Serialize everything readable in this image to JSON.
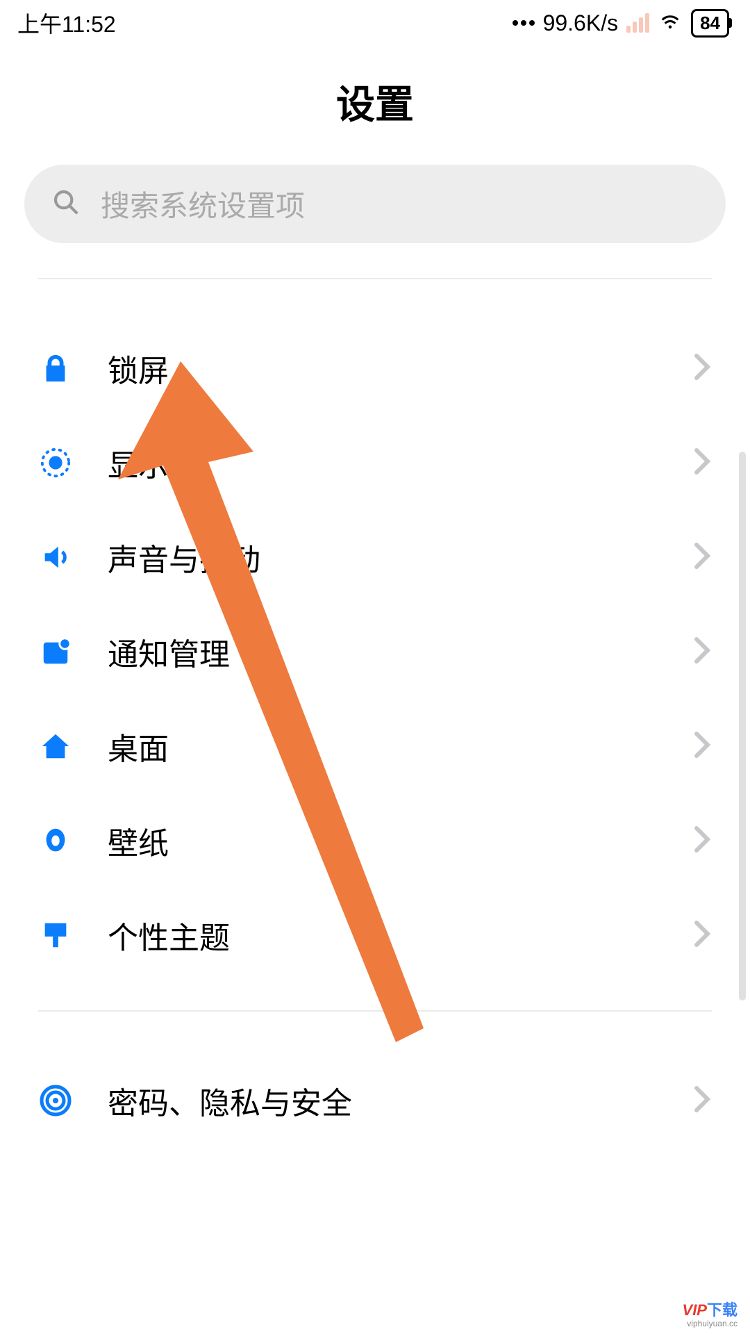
{
  "status_bar": {
    "time": "上午11:52",
    "net_speed": "99.6K/s",
    "battery_percent": "84"
  },
  "page": {
    "title": "设置"
  },
  "search": {
    "placeholder": "搜索系统设置项"
  },
  "items": {
    "lock": {
      "label": "锁屏"
    },
    "display": {
      "label": "显示"
    },
    "sound": {
      "label": "声音与振动"
    },
    "notify": {
      "label": "通知管理"
    },
    "home": {
      "label": "桌面"
    },
    "wallpaper": {
      "label": "壁纸"
    },
    "theme": {
      "label": "个性主题"
    },
    "security": {
      "label": "密码、隐私与安全"
    }
  },
  "watermark": {
    "main1": "VIP",
    "main2": "下载",
    "sub": "viphuiyuan.cc"
  }
}
